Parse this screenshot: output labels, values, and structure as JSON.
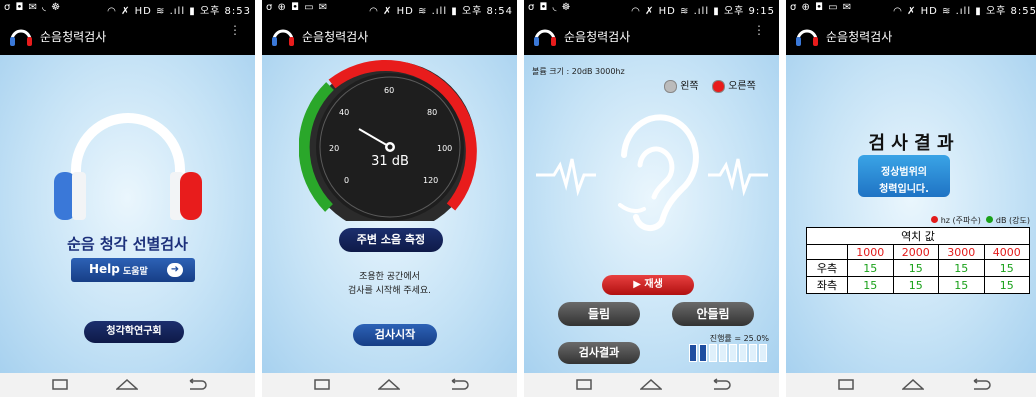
{
  "status": {
    "p1": {
      "left": "σ ◘ ✉ ◟ ☸",
      "right": "◠ ✗ HD ≋ .ıll ▮ 오후 8:53"
    },
    "p2": {
      "left": "σ ⊕ ◘ ▭ ✉",
      "right": "◠ ✗ HD ≋ .ıll ▮ 오후 8:54"
    },
    "p3": {
      "left": "σ ◘ ◟ ☸",
      "right": "◠ ✗ HD ≋ .ıll ▮ 오후 9:15"
    },
    "p4": {
      "left": "σ ⊕ ◘ ▭ ✉",
      "right": "◠ ✗ HD ≋ .ıll ▮ 오후 8:55"
    }
  },
  "app": {
    "title": "순음청력검사",
    "menu_icon": "⋮"
  },
  "screen1": {
    "heading": "순음 청각 선별검사",
    "help_label": "Help",
    "help_sub": "도움말",
    "help_arrow": "➜",
    "org_label": "청각학연구회"
  },
  "screen2": {
    "reading": "31 dB",
    "ticks": [
      "0",
      "20",
      "40",
      "60",
      "80",
      "100",
      "120"
    ],
    "measure_label": "주변 소음 측정",
    "message_line1": "조용한 공간에서",
    "message_line2": "검사를 시작해 주세요.",
    "start_label": "검사시작"
  },
  "screen3": {
    "volume": "볼륨 크기 : 20dB  3000hz",
    "left_label": "왼쪽",
    "right_label": "오른쪽",
    "play_label": "▶ 재생",
    "heard_label": "들림",
    "not_heard_label": "안들림",
    "progress_text": "진행률 = 25.0%",
    "progress": 0.25,
    "progress_segments": 8,
    "result_label": "검사결과"
  },
  "screen4": {
    "heading": "검 사 결 과",
    "normal_line1": "정상범위의",
    "normal_line2": "청력입니다.",
    "legend_hz": "hz (주파수)",
    "legend_db": "dB (강도)",
    "table_title": "역치 값",
    "freqs": [
      "1000",
      "2000",
      "3000",
      "4000"
    ],
    "rows": [
      {
        "label": "우측",
        "values": [
          "15",
          "15",
          "15",
          "15"
        ]
      },
      {
        "label": "좌측",
        "values": [
          "15",
          "15",
          "15",
          "15"
        ]
      }
    ]
  },
  "colors": {
    "blue_cup": "#3a78d8",
    "red_cup": "#e81c1c",
    "green": "#2aa72a",
    "hz_red": "#e21b1b",
    "value_green": "#1aa11a"
  }
}
